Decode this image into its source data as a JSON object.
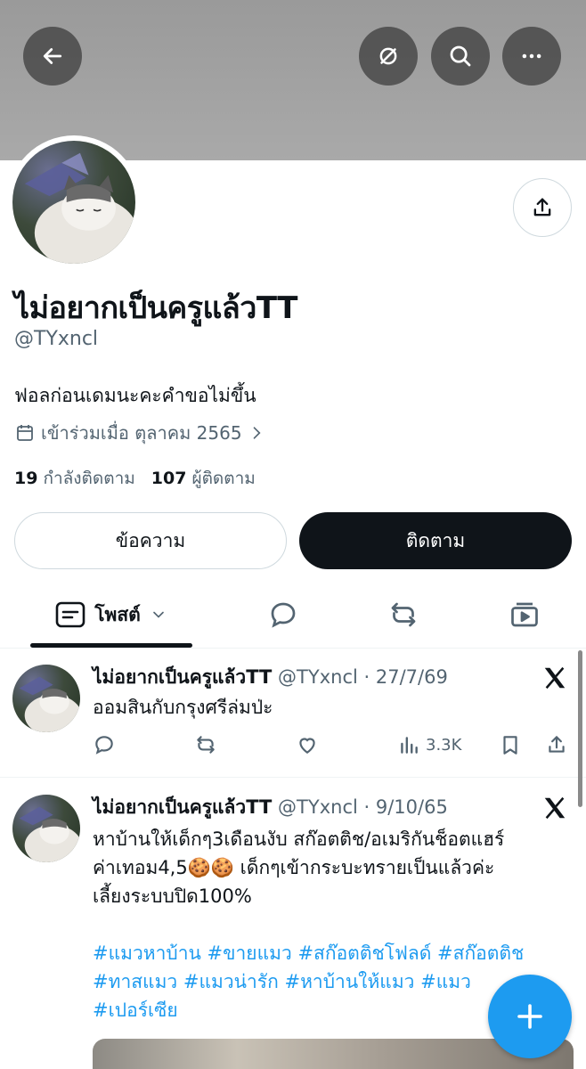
{
  "header": {
    "back_icon": "arrow-left-icon",
    "mute_icon": "slashed-circle-icon",
    "search_icon": "search-icon",
    "more_icon": "more-horizontal-icon"
  },
  "profile": {
    "name": "ไม่อยากเป็นครูแล้วTT",
    "handle": "@TYxncl",
    "bio": "ฟอลก่อนเดมนะคะคำขอไม่ขึ้น",
    "joined": "เข้าร่วมเมื่อ ตุลาคม 2565",
    "following_count": "19",
    "following_label": "กำลังติดตาม",
    "followers_count": "107",
    "followers_label": "ผู้ติดตาม",
    "message_button": "ข้อความ",
    "follow_button": "ติดตาม"
  },
  "tabs": {
    "posts_label": "โพสต์"
  },
  "posts": [
    {
      "name": "ไม่อยากเป็นครูแล้วTT",
      "meta": "@TYxncl · 27/7/69",
      "text": "ออมสินกับกรุงศรีล่มป่ะ",
      "views": "3.3K"
    },
    {
      "name": "ไม่อยากเป็นครูแล้วTT",
      "meta": "@TYxncl · 9/10/65",
      "line1": "หาบ้านให้เด็กๆ3เดือนงับ สก๊อตติช/อเมริกันช็อตแฮร์",
      "line2": "ค่าเทอม4,5🍪🍪 เด็กๆเข้ากระบะทรายเป็นแล้วค่ะ",
      "line3": "เลี้ยงระบบปิด100%",
      "tags1": "#แมวหาบ้าน #ขายแมว #สก๊อตติชโฟลด์ #สก๊อตติช",
      "tags2": "#ทาสแมว #แมวน่ารัก #หาบ้านให้แมว #แมว",
      "tags3": "#เปอร์เซีย"
    }
  ],
  "colors": {
    "accent": "#1d9bf0",
    "text": "#0f1419",
    "secondary": "#536471"
  }
}
